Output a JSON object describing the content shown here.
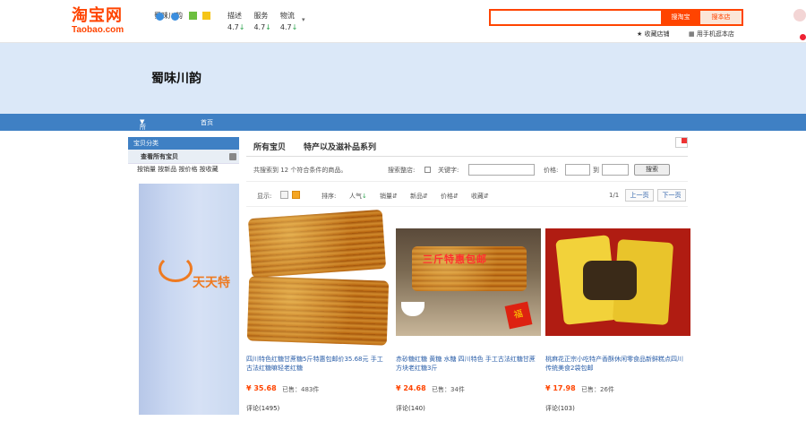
{
  "header": {
    "logo_cn": "淘宝网",
    "logo_en": "Taobao.com",
    "shop_name": "蜀味川韵",
    "ratings": [
      {
        "label": "描述",
        "score": "4.7"
      },
      {
        "label": "服务",
        "score": "4.7"
      },
      {
        "label": "物流",
        "score": "4.7"
      }
    ],
    "search_tb": "搜淘宝",
    "search_store": "搜本店",
    "fav": "收藏店铺",
    "mobile": "用手机逛本店"
  },
  "banner": {
    "title": "蜀味川韵"
  },
  "nav": {
    "all": "所有分类",
    "home": "首页"
  },
  "sidebar": {
    "header": "宝贝分类",
    "all": "查看所有宝贝",
    "sorts": "按销量 按新品 按价格 按收藏",
    "promo": "天天特"
  },
  "tabs": {
    "all": "所有宝贝",
    "cat": "特产以及滋补品系列"
  },
  "filter": {
    "found": "共搜索到 12 个符合条件的商品。",
    "search_store": "搜索整店:",
    "keyword": "关键字:",
    "price": "价格:",
    "to": "到",
    "submit": "搜索"
  },
  "sortbar": {
    "display": "显示:",
    "sort": "排序:",
    "items": [
      "人气",
      "销量",
      "新品",
      "价格",
      "收藏"
    ],
    "page": "1/1",
    "prev": "上一页",
    "next": "下一页"
  },
  "products": [
    {
      "name": "四川特色红糖甘蔗糖5斤特惠包邮价35.68元 手工古法红糖嘛轻老红糖",
      "price": "¥ 35.68",
      "sold": "已售：483件",
      "reviews": "评论(1495)"
    },
    {
      "name": "赤砂糖红糖 黄糖 水糖 四川特色 手工古法红糖甘蔗方块老红糖3斤",
      "price": "¥ 24.68",
      "sold": "已售：34件",
      "reviews": "评论(140)",
      "img_text": "三斤特惠包邮"
    },
    {
      "name": "桃麻花正宗小吃特产香酥休闲零食品新鲜糕点四川传统美食2袋包邮",
      "price": "¥ 17.98",
      "sold": "已售：26件",
      "reviews": "评论(103)"
    }
  ]
}
